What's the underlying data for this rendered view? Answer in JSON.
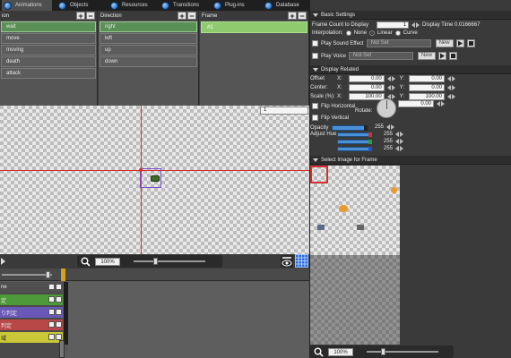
{
  "tabs": [
    {
      "label": "Animations",
      "active": true
    },
    {
      "label": "Objects",
      "active": false
    },
    {
      "label": "Resources",
      "active": false
    },
    {
      "label": "Transitions",
      "active": false
    },
    {
      "label": "Plug-ins",
      "active": false
    },
    {
      "label": "Database",
      "active": false
    }
  ],
  "animation_panel": {
    "header": "ion",
    "add_label": "+",
    "remove_label": "−",
    "items": [
      "wait",
      "move",
      "moving",
      "death",
      "attack"
    ]
  },
  "direction_panel": {
    "header": "Direction",
    "add_label": "+",
    "remove_label": "−",
    "items": [
      "right",
      "left",
      "up",
      "down"
    ]
  },
  "frame_panel": {
    "header": "Frame",
    "add_label": "+",
    "remove_label": "−",
    "items": [
      "1",
      "#1"
    ]
  },
  "canvas": {
    "frame_number": "1",
    "zoom_value": "100%"
  },
  "timeline": {
    "rows": [
      {
        "label": "ne",
        "color": "#4a4a4a"
      },
      {
        "label": "定",
        "color": "#4e9a3a"
      },
      {
        "label": "り判定",
        "color": "#6a58b8"
      },
      {
        "label": "判定",
        "color": "#b84848"
      },
      {
        "label": "域",
        "color": "#c8c838"
      }
    ]
  },
  "basic_settings": {
    "title": "Basic Settings",
    "frame_count_label": "Frame Count to Display",
    "frame_count_value": "1",
    "display_time_label": "Display Time 0.0166667",
    "interpolation_label": "Interpolation:",
    "interp_none": "None",
    "interp_linear": "Linear",
    "interp_curve": "Curve",
    "play_sound_label": "Play Sound Effect",
    "play_sound_value": "Not Set",
    "play_voice_label": "Play Voice",
    "play_voice_value": "Not Set",
    "new_label": "New"
  },
  "display_related": {
    "title": "Display Related",
    "offset_label": "Offset",
    "center_label": "Center:",
    "scale_label": "Scale (%):",
    "x_label": "X:",
    "y_label": "Y:",
    "offset_x": "0.00",
    "offset_y": "0.00",
    "center_x": "0.00",
    "center_y": "0.00",
    "scale_x": "100.00",
    "scale_y": "100.00",
    "flip_h_label": "Flip Horizontal",
    "rotate_label": "Rotate:",
    "rotate_value": "0.00",
    "flip_v_label": "Flip Vertical",
    "opacity_label": "Opacity",
    "opacity_value": "255",
    "adjust_hue_label": "Adjust Hue",
    "hue_r": "255",
    "hue_g": "255",
    "hue_b": "255"
  },
  "image_select": {
    "title": "Select Image for Frame",
    "zoom_value": "100%"
  },
  "colors": {
    "accent_green": "#8fca6f",
    "selected_item": "#5a8f55",
    "guide_red": "#d23030"
  }
}
